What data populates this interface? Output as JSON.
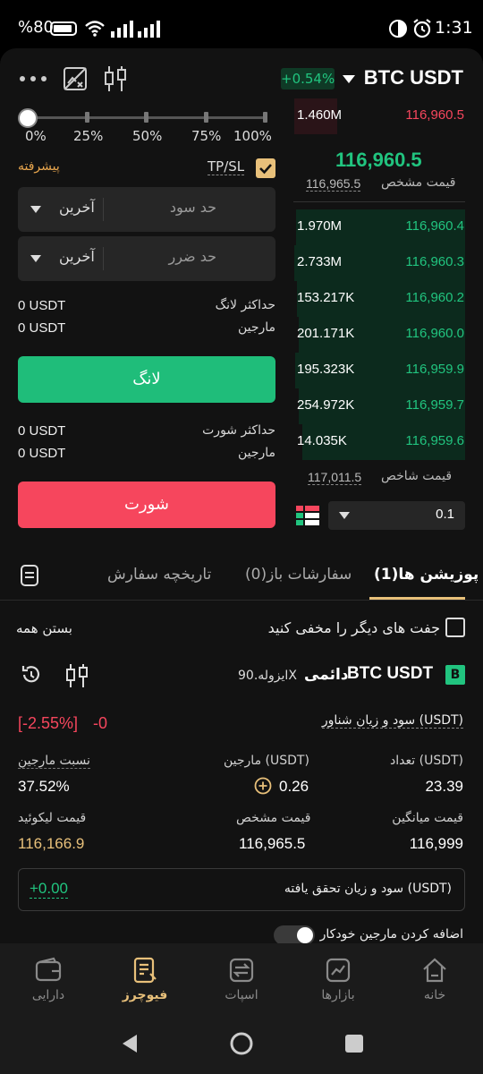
{
  "status_bar": {
    "battery": "%80",
    "time": "1:31"
  },
  "header": {
    "change_pct": "+0.54%",
    "pair": "BTC USDT",
    "more_icon": "more-icon",
    "chart_icon": "chart-off-icon",
    "candle_icon": "candlestick-icon"
  },
  "slider": {
    "labels": [
      "0%",
      "25%",
      "50%",
      "75%",
      "100%"
    ],
    "value_pct": 0
  },
  "order_form": {
    "advanced": "پیشرفته",
    "tpsl_label": "TP/SL",
    "tpsl_checked": true,
    "take_profit": {
      "placeholder": "حد سود",
      "unit": "آخرین"
    },
    "stop_loss": {
      "placeholder": "حد ضرر",
      "unit": "آخرین"
    },
    "max_long_label": "حداکثر لانگ",
    "max_long_value": "0 USDT",
    "margin_label": "مارجین",
    "margin_long_value": "0 USDT",
    "long_button": "لانگ",
    "max_short_label": "حداکثر شورت",
    "max_short_value": "0 USDT",
    "margin_short_value": "0 USDT",
    "short_button": "شورت"
  },
  "orderbook": {
    "asks": [
      {
        "qty": "1.460M",
        "price": "116,960.5"
      }
    ],
    "last_price": "116,960.5",
    "mark_price_label": "قیمت مشخص",
    "mark_price": "116,965.5",
    "bids": [
      {
        "qty": "1.970M",
        "price": "116,960.4"
      },
      {
        "qty": "2.733M",
        "price": "116,960.3"
      },
      {
        "qty": "153.217K",
        "price": "116,960.2"
      },
      {
        "qty": "201.171K",
        "price": "116,960.0"
      },
      {
        "qty": "195.323K",
        "price": "116,959.9"
      },
      {
        "qty": "254.972K",
        "price": "116,959.7"
      },
      {
        "qty": "14.035K",
        "price": "116,959.6"
      }
    ],
    "index_price_label": "قیمت شاخص",
    "index_price": "117,011.5",
    "step_value": "0.1"
  },
  "tabs": {
    "positions": "پوزیشن ها(1)",
    "open_orders": "سفارشات باز(0)",
    "order_history": "تاریخچه سفارش"
  },
  "positions_panel": {
    "hide_other_pairs": "جفت های دیگر را مخفی کنید",
    "close_all": "بستن همه",
    "position": {
      "side_badge": "B",
      "pair": "BTC USDT",
      "type": "دائمی",
      "mode": "ایزوله.90X",
      "unrealized_label": "سود و زیان شناور (USDT)",
      "unrealized_value": "-0",
      "unrealized_pct": "[-2.55%]",
      "quantity_label": "تعداد (USDT)",
      "quantity_value": "23.39",
      "margin_label": "مارجین (USDT)",
      "margin_value": "0.26",
      "margin_ratio_label": "نسبت مارجین",
      "margin_ratio_value": "37.52%",
      "avg_price_label": "قیمت میانگین",
      "avg_price_value": "116,999",
      "mark_price_label": "قیمت مشخص",
      "mark_price_value": "116,965.5",
      "liq_price_label": "قیمت لیکوئید",
      "liq_price_value": "116,166.9",
      "realized_label": "سود و زیان تحقق یافته (USDT)",
      "realized_value": "+0.00",
      "auto_margin_label": "اضافه کردن مارجین خودکار"
    }
  },
  "bottom_nav": [
    {
      "label": "خانه",
      "icon": "home-icon"
    },
    {
      "label": "بازارها",
      "icon": "markets-icon"
    },
    {
      "label": "اسپات",
      "icon": "spot-icon"
    },
    {
      "label": "فیوچرز",
      "icon": "futures-icon",
      "active": true
    },
    {
      "label": "دارایی",
      "icon": "wallet-icon"
    }
  ],
  "colors": {
    "green": "#21c47f",
    "red": "#f6465d",
    "gold": "#e8c07a",
    "bg": "#121212"
  }
}
